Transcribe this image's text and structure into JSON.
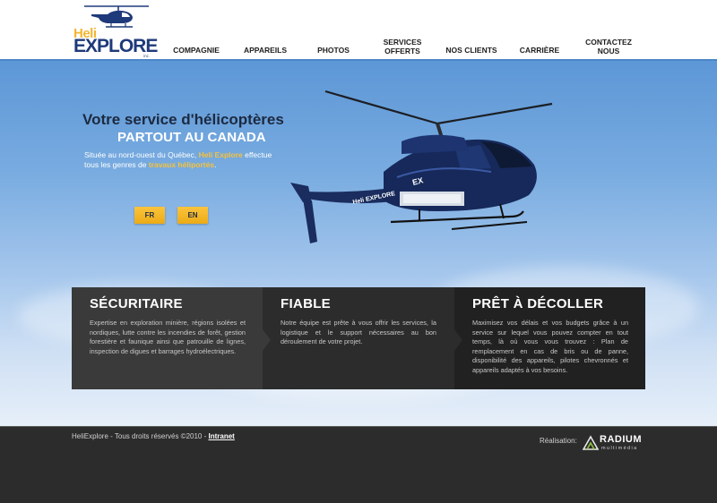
{
  "brand": {
    "logo_heli": "Heli",
    "logo_explore": "EXPLORE",
    "logo_inc": "inc."
  },
  "nav": {
    "items": [
      {
        "label": "COMPAGNIE"
      },
      {
        "label": "APPAREILS"
      },
      {
        "label": "PHOTOS"
      },
      {
        "label": "SERVICES\nOFFERTS"
      },
      {
        "label": "NOS CLIENTS"
      },
      {
        "label": "CARRIÈRE"
      },
      {
        "label": "CONTACTEZ\nNOUS"
      }
    ]
  },
  "hero": {
    "title_line1": "Votre service d'hélicoptères",
    "title_line2": "PARTOUT AU CANADA",
    "desc_part1": "Située au nord-ouest du Québec, ",
    "desc_highlight1": "Heli Explore",
    "desc_part2": " effectue tous les genres de ",
    "desc_highlight2": "travaux héliportés",
    "desc_part3": ".",
    "heli_marking1": "EX",
    "heli_marking2": "Heli EXPLORE",
    "lang_fr": "FR",
    "lang_en": "EN"
  },
  "features": [
    {
      "title": "SÉCURITAIRE",
      "text": "Expertise en exploration minière, régions isolées et nordiques, lutte contre les incendies de forêt, gestion forestière et faunique ainsi que patrouille de lignes, inspection de digues et barrages hydroélectriques."
    },
    {
      "title": "FIABLE",
      "text": "Notre équipe est prête à vous offrir les services, la logistique et le support nécessaires au bon déroulement de votre projet."
    },
    {
      "title": "PRÊT À DÉCOLLER",
      "text": "Maximisez vos délais et vos budgets grâce à un service sur lequel vous pouvez compter en tout temps, là où vous vous trouvez : Plan de remplacement en cas de bris ou de panne, disponibilité des appareils, pilotes chevronnés et appareils adaptés à vos besoins."
    }
  ],
  "footer": {
    "copyright": "HeliExplore - Tous droits réservés ©2010 - ",
    "intranet": "Intranet",
    "realisation": "Réalisation:",
    "radium": "RADIUM",
    "radium_sub": "multimédia"
  },
  "colors": {
    "accent_yellow": "#f6c23a",
    "brand_blue": "#1f3a7a",
    "dark_panel": "#2c2c2c"
  }
}
